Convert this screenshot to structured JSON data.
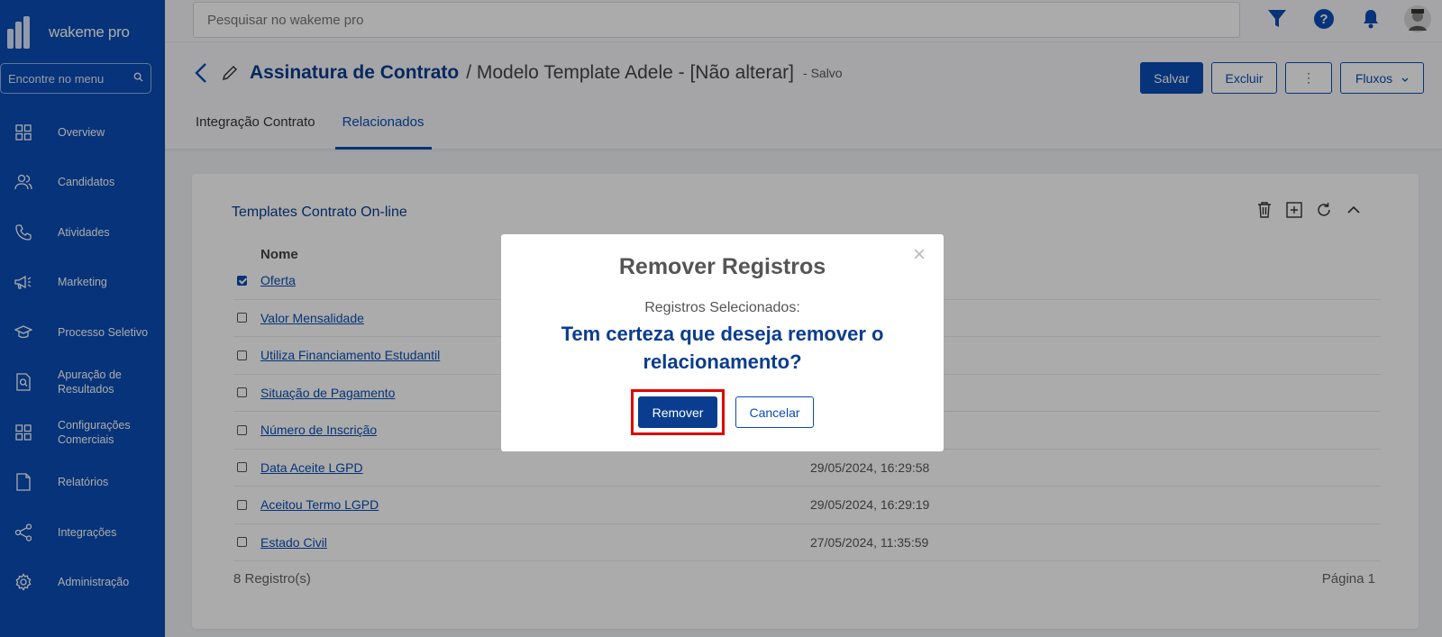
{
  "app": {
    "logo_text": "wakeme pro"
  },
  "sidebar": {
    "search_label": "Encontre no menu",
    "items": [
      {
        "label": "Overview",
        "icon": "grid-icon"
      },
      {
        "label": "Candidatos",
        "icon": "users-icon"
      },
      {
        "label": "Atividades",
        "icon": "phone-icon"
      },
      {
        "label": "Marketing",
        "icon": "megaphone-icon"
      },
      {
        "label": "Processo Seletivo",
        "icon": "graduation-cap-icon"
      },
      {
        "label": "Apuração de Resultados",
        "icon": "document-search-icon"
      },
      {
        "label": "Configurações Comerciais",
        "icon": "grid-icon"
      },
      {
        "label": "Relatórios",
        "icon": "report-icon"
      },
      {
        "label": "Integrações",
        "icon": "share-icon"
      },
      {
        "label": "Administração",
        "icon": "gear-icon"
      }
    ]
  },
  "topbar": {
    "search_placeholder": "Pesquisar no wakeme pro"
  },
  "header": {
    "title": "Assinatura de Contrato",
    "subtitle": "/ Modelo Template Adele - [Não alterar]",
    "status": "- Salvo",
    "buttons": {
      "save": "Salvar",
      "delete": "Excluir",
      "more": "⋮",
      "flows": "Fluxos"
    },
    "tabs": [
      "Integração Contrato",
      "Relacionados"
    ]
  },
  "panel": {
    "title": "Templates Contrato On-line",
    "column_name": "Nome",
    "rows": [
      {
        "name": "Oferta",
        "date": "",
        "checked": true
      },
      {
        "name": "Valor Mensalidade",
        "date": "",
        "checked": false
      },
      {
        "name": "Utiliza Financiamento Estudantil",
        "date": "",
        "checked": false
      },
      {
        "name": "Situação de Pagamento",
        "date": "",
        "checked": false
      },
      {
        "name": "Número de Inscrição",
        "date": "",
        "checked": false
      },
      {
        "name": "Data Aceite LGPD",
        "date": "29/05/2024, 16:29:58",
        "checked": false
      },
      {
        "name": "Aceitou Termo LGPD",
        "date": "29/05/2024, 16:29:19",
        "checked": false
      },
      {
        "name": "Estado Civil",
        "date": "27/05/2024, 11:35:59",
        "checked": false
      }
    ],
    "record_count": "8 Registro(s)",
    "page": "Página 1"
  },
  "modal": {
    "title": "Remover Registros",
    "subtitle": "Registros Selecionados:",
    "question": "Tem certeza que deseja remover o relacionamento?",
    "remove_label": "Remover",
    "cancel_label": "Cancelar",
    "close_glyph": "×"
  },
  "colors": {
    "brand": "#0a4cb5",
    "title": "#0a3d8f",
    "highlight": "#e00000"
  }
}
